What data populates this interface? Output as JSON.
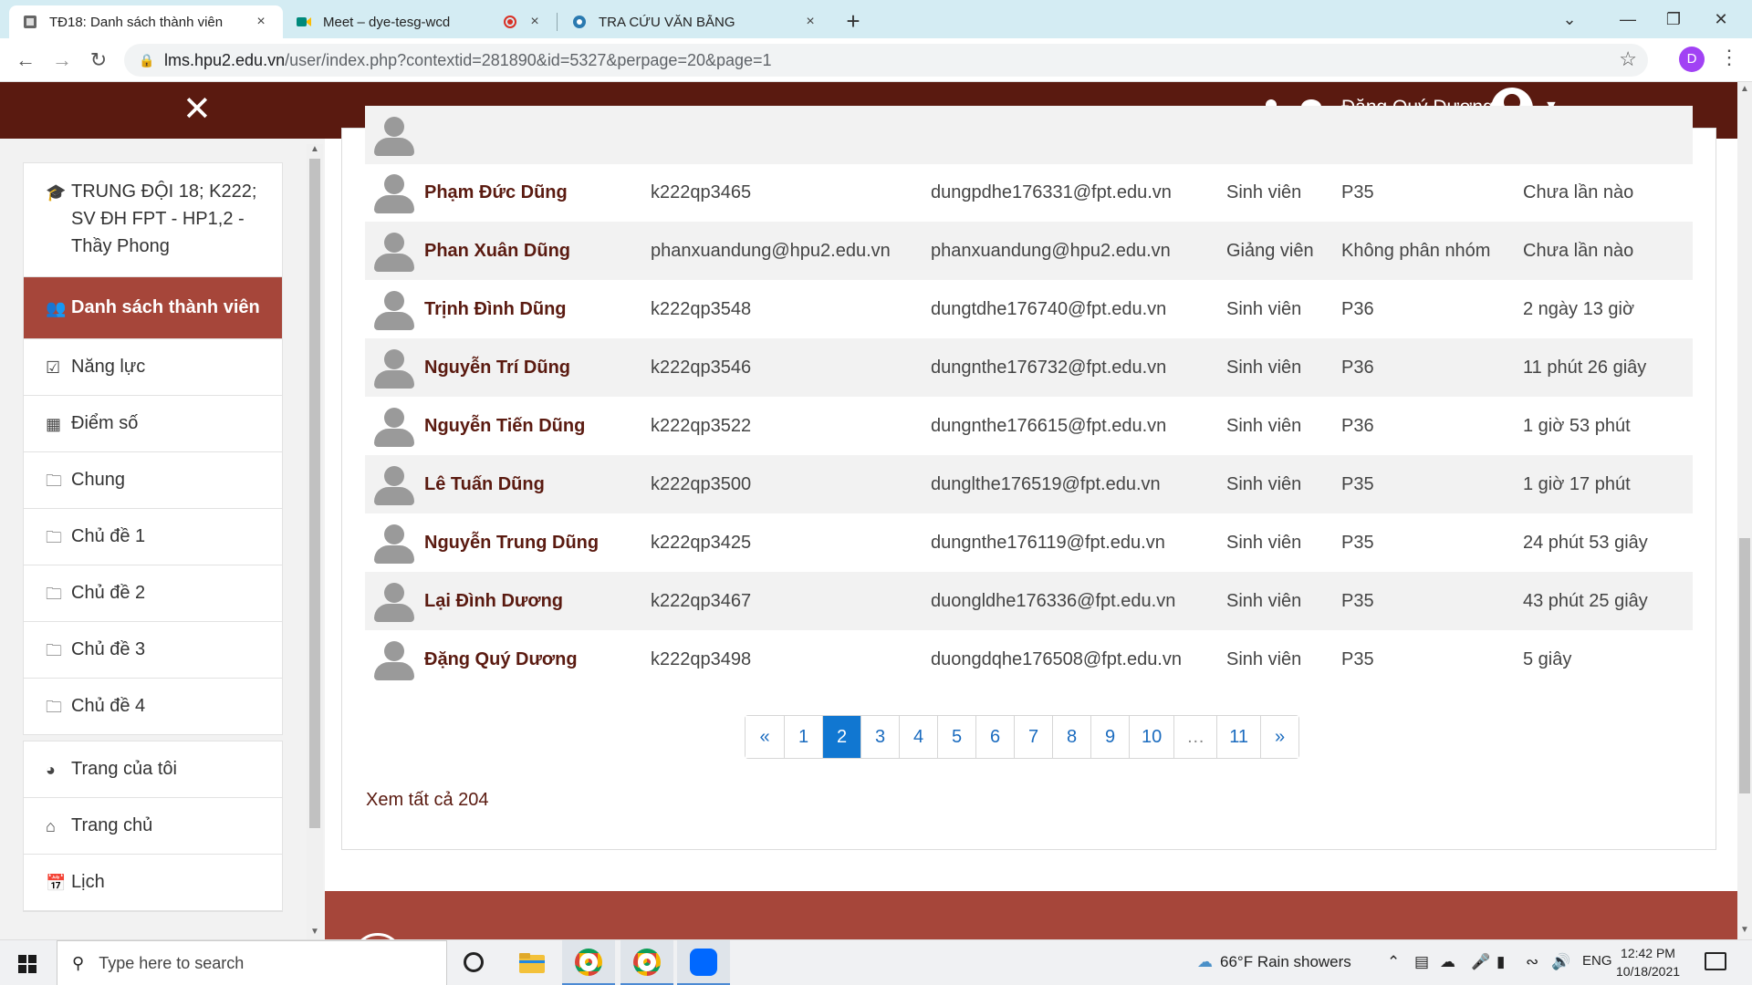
{
  "browser": {
    "tabs": [
      {
        "label": "TĐ18: Danh sách thành viên",
        "close": "×"
      },
      {
        "label": "Meet – dye-tesg-wcd",
        "close": "×"
      },
      {
        "label": "TRA CỨU VĂN BẰNG",
        "close": "×"
      }
    ],
    "new_tab": "+",
    "url_host": "lms.hpu2.edu.vn",
    "url_path": "/user/index.php?contextid=281890&id=5327&perpage=20&page=1",
    "profile_initial": "D"
  },
  "header": {
    "user_name": "Đặng Quý Dương",
    "colors": {
      "bar": "#5a1a10",
      "accent": "#a6463a"
    }
  },
  "sidebar": {
    "course_title": "TRUNG ĐỘI 18; K222; SV ĐH FPT - HP1,2 - Thầy Phong",
    "items": [
      {
        "label": "Danh sách thành viên",
        "icon": "users-icon",
        "active": true
      },
      {
        "label": "Năng lực",
        "icon": "checkbox-icon"
      },
      {
        "label": "Điểm số",
        "icon": "table-icon"
      },
      {
        "label": "Chung",
        "icon": "folder-icon"
      },
      {
        "label": "Chủ đề 1",
        "icon": "folder-icon"
      },
      {
        "label": "Chủ đề 2",
        "icon": "folder-icon"
      },
      {
        "label": "Chủ đề 3",
        "icon": "folder-icon"
      },
      {
        "label": "Chủ đề 4",
        "icon": "folder-icon"
      }
    ],
    "items2": [
      {
        "label": "Trang của tôi",
        "icon": "dashboard-icon"
      },
      {
        "label": "Trang chủ",
        "icon": "home-icon"
      },
      {
        "label": "Lịch",
        "icon": "calendar-icon"
      }
    ]
  },
  "participants": {
    "rows": [
      {
        "name": "Phạm Đức Dũng",
        "id": "k222qp3465",
        "email": "dungpdhe176331@fpt.edu.vn",
        "role": "Sinh viên",
        "group": "P35",
        "last": "Chưa lần nào"
      },
      {
        "name": "Phan Xuân Dũng",
        "id": "phanxuandung@hpu2.edu.vn",
        "email": "phanxuandung@hpu2.edu.vn",
        "role": "Giảng viên",
        "group": "Không phân nhóm",
        "last": "Chưa lần nào"
      },
      {
        "name": "Trịnh Đình Dũng",
        "id": "k222qp3548",
        "email": "dungtdhe176740@fpt.edu.vn",
        "role": "Sinh viên",
        "group": "P36",
        "last": "2 ngày 13 giờ"
      },
      {
        "name": "Nguyễn Trí Dũng",
        "id": "k222qp3546",
        "email": "dungnthe176732@fpt.edu.vn",
        "role": "Sinh viên",
        "group": "P36",
        "last": "11 phút 26 giây"
      },
      {
        "name": "Nguyễn Tiến Dũng",
        "id": "k222qp3522",
        "email": "dungnthe176615@fpt.edu.vn",
        "role": "Sinh viên",
        "group": "P36",
        "last": "1 giờ 53 phút"
      },
      {
        "name": "Lê Tuấn Dũng",
        "id": "k222qp3500",
        "email": "dunglthe176519@fpt.edu.vn",
        "role": "Sinh viên",
        "group": "P35",
        "last": "1 giờ 17 phút"
      },
      {
        "name": "Nguyễn Trung Dũng",
        "id": "k222qp3425",
        "email": "dungnthe176119@fpt.edu.vn",
        "role": "Sinh viên",
        "group": "P35",
        "last": "24 phút 53 giây"
      },
      {
        "name": "Lại Đình Dương",
        "id": "k222qp3467",
        "email": "duongldhe176336@fpt.edu.vn",
        "role": "Sinh viên",
        "group": "P35",
        "last": "43 phút 25 giây"
      },
      {
        "name": "Đặng Quý Dương",
        "id": "k222qp3498",
        "email": "duongdqhe176508@fpt.edu.vn",
        "role": "Sinh viên",
        "group": "P35",
        "last": "5 giây"
      }
    ],
    "pagination": [
      "«",
      "1",
      "2",
      "3",
      "4",
      "5",
      "6",
      "7",
      "8",
      "9",
      "10",
      "…",
      "11",
      "»"
    ],
    "current_page": "2",
    "view_all": "Xem tất cả 204"
  },
  "taskbar": {
    "search_placeholder": "Type here to search",
    "weather": "66°F  Rain showers",
    "lang": "ENG",
    "time": "12:42 PM",
    "date": "10/18/2021"
  }
}
